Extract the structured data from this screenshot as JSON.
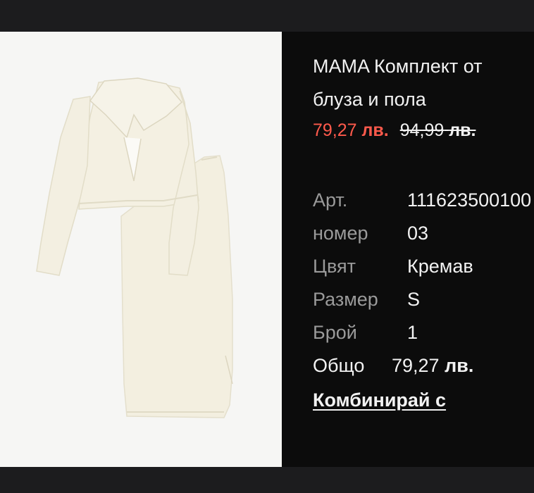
{
  "product": {
    "title": "MAMA Комплект от блуза и пола",
    "price_current": "79,27",
    "price_old": "94,99",
    "currency": "лв.",
    "image_alt": "Cream blouse and skirt set",
    "colors": {
      "sale": "#ff5a4c",
      "fabric": "#f3efe0"
    }
  },
  "details": {
    "art_label_1": "Арт.",
    "art_label_2": "номер",
    "art_value_1": "111623500100",
    "art_value_2": "03",
    "color_label": "Цвят",
    "color_value": "Кремав",
    "size_label": "Размер",
    "size_value": "S",
    "qty_label": "Брой",
    "qty_value": "1",
    "total_label": "Общо",
    "total_value": "79,27",
    "total_currency": "лв."
  },
  "actions": {
    "combine_link": "Комбинирай с"
  }
}
